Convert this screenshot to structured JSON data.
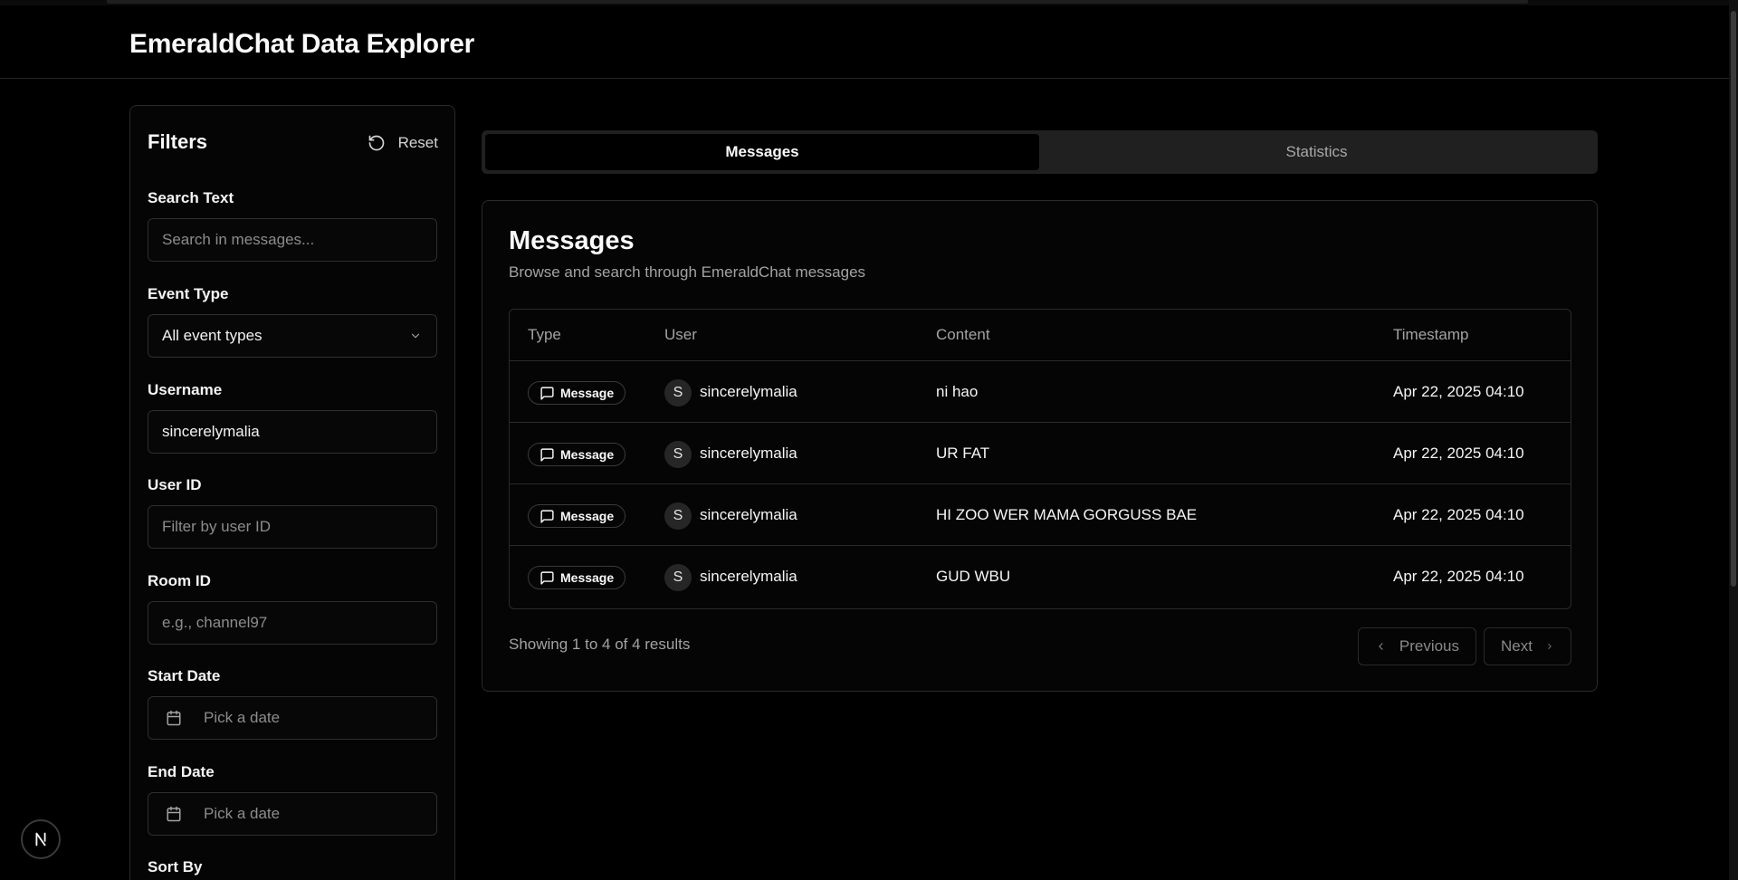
{
  "app": {
    "title": "EmeraldChat Data Explorer"
  },
  "filters": {
    "title": "Filters",
    "reset_label": "Reset",
    "search": {
      "label": "Search Text",
      "placeholder": "Search in messages..."
    },
    "event_type": {
      "label": "Event Type",
      "value": "All event types"
    },
    "username": {
      "label": "Username",
      "value": "sincerelymalia"
    },
    "user_id": {
      "label": "User ID",
      "placeholder": "Filter by user ID"
    },
    "room_id": {
      "label": "Room ID",
      "placeholder": "e.g., channel97"
    },
    "start_date": {
      "label": "Start Date",
      "placeholder": "Pick a date"
    },
    "end_date": {
      "label": "End Date",
      "placeholder": "Pick a date"
    },
    "sort_by": {
      "label": "Sort By"
    }
  },
  "tabs": [
    {
      "label": "Messages",
      "active": true
    },
    {
      "label": "Statistics",
      "active": false
    }
  ],
  "messages": {
    "title": "Messages",
    "subtitle": "Browse and search through EmeraldChat messages",
    "columns": [
      "Type",
      "User",
      "Content",
      "Timestamp"
    ],
    "rows": [
      {
        "type": "Message",
        "avatar": "S",
        "user": "sincerelymalia",
        "content": "ni hao",
        "timestamp": "Apr 22, 2025 04:10"
      },
      {
        "type": "Message",
        "avatar": "S",
        "user": "sincerelymalia",
        "content": "UR FAT",
        "timestamp": "Apr 22, 2025 04:10"
      },
      {
        "type": "Message",
        "avatar": "S",
        "user": "sincerelymalia",
        "content": "HI ZOO WER MAMA GORGUSS BAE",
        "timestamp": "Apr 22, 2025 04:10"
      },
      {
        "type": "Message",
        "avatar": "S",
        "user": "sincerelymalia",
        "content": "GUD WBU",
        "timestamp": "Apr 22, 2025 04:10"
      }
    ],
    "showing": "Showing 1 to 4 of 4 results",
    "prev_label": "Previous",
    "next_label": "Next"
  },
  "icons": {
    "reset": "rotate-ccw-icon",
    "chevron": "chevron-down-icon",
    "calendar": "calendar-icon",
    "message": "message-square-icon",
    "logo": "nextjs-logo-icon"
  }
}
